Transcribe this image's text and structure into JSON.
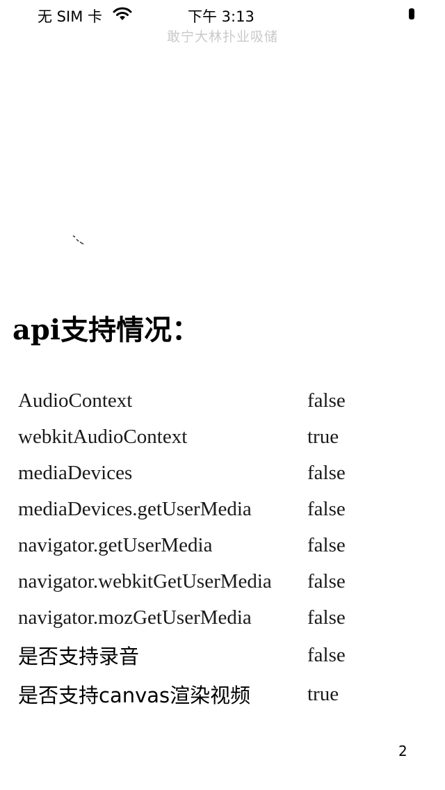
{
  "status_bar": {
    "carrier": "无 SIM 卡",
    "time": "下午 3:13",
    "wifi_icon": "wifi-icon",
    "battery_icon": "battery-icon"
  },
  "page": {
    "title": "敢宁大林扑业吸储"
  },
  "section": {
    "heading": "api支持情况："
  },
  "api_support": [
    {
      "name": "AudioContext",
      "value": "false"
    },
    {
      "name": "webkitAudioContext",
      "value": "true"
    },
    {
      "name": "mediaDevices",
      "value": "false"
    },
    {
      "name": "mediaDevices.getUserMedia",
      "value": "false"
    },
    {
      "name": "navigator.getUserMedia",
      "value": "false"
    },
    {
      "name": "navigator.webkitGetUserMedia",
      "value": "false"
    },
    {
      "name": "navigator.mozGetUserMedia",
      "value": "false"
    },
    {
      "name": "是否支持录音",
      "value": "false"
    },
    {
      "name": "是否支持canvas渲染视频",
      "value": "true"
    }
  ],
  "page_number": "2"
}
